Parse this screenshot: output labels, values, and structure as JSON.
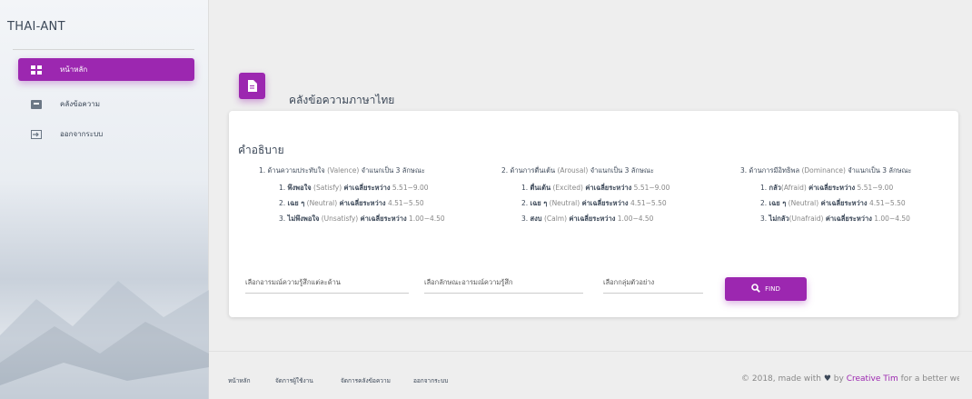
{
  "brand": "THAI-ANT",
  "sidebar": {
    "items": [
      {
        "label": "หน้าหลัก",
        "icon": "dashboard-icon",
        "active": true
      },
      {
        "label": "คลังข้อความ",
        "icon": "library-icon",
        "active": false
      },
      {
        "label": "ออกจากระบบ",
        "icon": "logout-icon",
        "active": false
      }
    ]
  },
  "card": {
    "icon": "document-icon",
    "title": "คลังข้อความภาษาไทย",
    "description_title": "คำอธิบาย",
    "columns": [
      {
        "head_prefix": "1. ด้านความประทับใจ ",
        "head_en": "(Valence)",
        "head_suffix": " จำแนกเป็น 3 ลักษณะ",
        "items": [
          {
            "num": "1. ",
            "th": "พึงพอใจ",
            "en": " (Satisfy) ",
            "mid": "ค่าเฉลี่ยระหว่าง",
            "range": " 5.51−9.00"
          },
          {
            "num": "2. ",
            "th": "เฉย ๆ",
            "en": " (Neutral) ",
            "mid": "ค่าเฉลี่ยระหว่าง",
            "range": " 4.51−5.50"
          },
          {
            "num": "3. ",
            "th": "ไม่พึงพอใจ",
            "en": " (Unsatisfy) ",
            "mid": "ค่าเฉลี่ยระหว่าง",
            "range": " 1.00−4.50"
          }
        ]
      },
      {
        "head_prefix": "2. ด้านการตื่นเต้น ",
        "head_en": "(Arousal)",
        "head_suffix": " จำแนกเป็น 3 ลักษณะ",
        "items": [
          {
            "num": "1. ",
            "th": "ตื่นเต้น",
            "en": " (Excited) ",
            "mid": "ค่าเฉลี่ยระหว่าง",
            "range": " 5.51−9.00"
          },
          {
            "num": "2. ",
            "th": "เฉย ๆ",
            "en": " (Neutral) ",
            "mid": "ค่าเฉลี่ยระหว่าง",
            "range": " 4.51−5.50"
          },
          {
            "num": "3. ",
            "th": "สงบ",
            "en": " (Calm) ",
            "mid": "ค่าเฉลี่ยระหว่าง",
            "range": " 1.00−4.50"
          }
        ]
      },
      {
        "head_prefix": "3. ด้านการมีอิทธิพล ",
        "head_en": "(Dominance)",
        "head_suffix": " จำแนกเป็น 3 ลักษณะ",
        "items": [
          {
            "num": "1. ",
            "th": "กลัว",
            "en": "(Afraid) ",
            "mid": "ค่าเฉลี่ยระหว่าง",
            "range": " 5.51−9.00"
          },
          {
            "num": "2. ",
            "th": "เฉย ๆ",
            "en": " (Neutral) ",
            "mid": "ค่าเฉลี่ยระหว่าง",
            "range": " 4.51−5.50"
          },
          {
            "num": "3. ",
            "th": "ไม่กลัว",
            "en": "(Unafraid) ",
            "mid": "ค่าเฉลี่ยระหว่าง",
            "range": " 1.00−4.50"
          }
        ]
      }
    ],
    "selects": [
      {
        "label": "เลือกอารมณ์ความรู้สึกแต่ละด้าน"
      },
      {
        "label": "เลือกลักษณะอารมณ์ความรู้สึก"
      },
      {
        "label": "เลือกกลุ่มตัวอย่าง"
      }
    ],
    "find_label": "FIND"
  },
  "footer": {
    "links": [
      "หน้าหลัก",
      "จัดการผู้ใช้งาน",
      "จัดการคลังข้อความ",
      "ออกจากระบบ"
    ],
    "copy_prefix": "© 2018, made with ",
    "copy_by": " by ",
    "copy_brand": "Creative Tim",
    "copy_suffix": " for a better web."
  },
  "colors": {
    "accent": "#9c27b0"
  }
}
